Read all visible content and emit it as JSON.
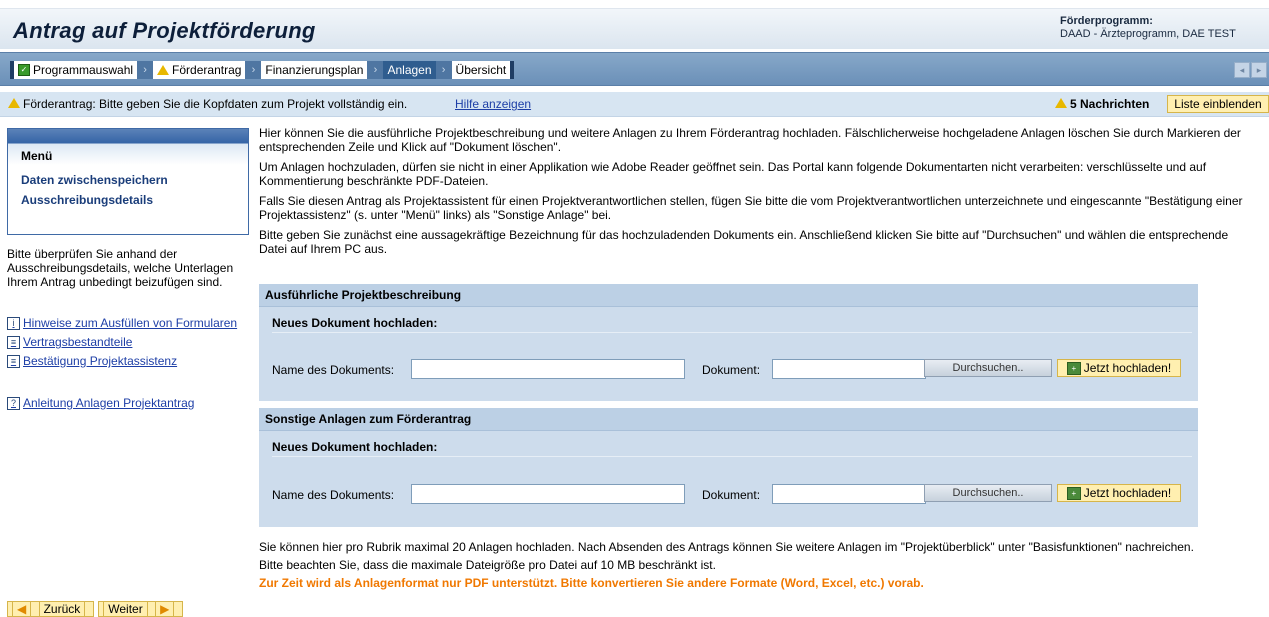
{
  "header": {
    "title": "Antrag auf Projektförderung",
    "program_label": "Förderprogramm:",
    "program_value": "DAAD - Ärzteprogramm, DAE TEST"
  },
  "steps": [
    {
      "label": "Programmauswahl",
      "icon": "check-icon"
    },
    {
      "label": "Förderantrag",
      "icon": "warning-icon"
    },
    {
      "label": "Finanzierungsplan",
      "icon": ""
    },
    {
      "label": "Anlagen",
      "icon": "",
      "active": true
    },
    {
      "label": "Übersicht",
      "icon": ""
    }
  ],
  "messagebar": {
    "message": "Förderantrag: Bitte geben Sie die Kopfdaten zum Projekt vollständig ein.",
    "help": "Hilfe anzeigen",
    "count": "5 Nachrichten",
    "list_button": "Liste einblenden"
  },
  "menu": {
    "title": "Menü",
    "items": [
      "Daten zwischenspeichern",
      "Ausschreibungsdetails"
    ]
  },
  "sidebar": {
    "text": "Bitte überprüfen Sie anhand der Ausschreibungsdetails, welche Unterlagen Ihrem Antrag unbedingt beizufügen sind.",
    "links": [
      "Hinweise zum Ausfüllen von Formularen",
      "Vertragsbestandteile",
      "Bestätigung Projektassistenz",
      "Anleitung Anlagen Projektantrag"
    ]
  },
  "main": {
    "p1": "Hier können Sie die ausführliche Projektbeschreibung und weitere Anlagen zu Ihrem Förderantrag hochladen. Fälschlicherweise hochgeladene Anlagen löschen Sie durch Markieren der entsprechenden Zeile und Klick auf \"Dokument löschen\".",
    "p2": "Um Anlagen hochzuladen, dürfen sie nicht in einer Applikation wie Adobe Reader geöffnet sein. Das Portal kann folgende Dokumentarten nicht verarbeiten: verschlüsselte und auf Kommentierung beschränkte PDF-Dateien.",
    "p3": "Falls Sie diesen Antrag als Projektassistent für einen Projektverantwortlichen stellen, fügen Sie bitte die vom Projektverantwortlichen unterzeichnete und eingescannte \"Bestätigung einer Projektassistenz\" (s. unter \"Menü\" links) als \"Sonstige Anlage\" bei.",
    "p4": "Bitte geben Sie zunächst eine aussagekräftige Bezeichnung für das hochzuladenden Dokuments ein. Anschließend klicken Sie bitte auf \"Durchsuchen\" und wählen die entsprechende Datei auf Ihrem PC aus."
  },
  "sections": [
    {
      "title": "Ausführliche Projektbeschreibung",
      "subtitle": "Neues Dokument hochladen:",
      "name_label": "Name des Dokuments:",
      "name_value": "",
      "doc_label": "Dokument:",
      "doc_value": "",
      "browse": "Durchsuchen..",
      "upload": "Jetzt hochladen!"
    },
    {
      "title": "Sonstige Anlagen zum Förderantrag",
      "subtitle": "Neues Dokument hochladen:",
      "name_label": "Name des Dokuments:",
      "name_value": "",
      "doc_label": "Dokument:",
      "doc_value": "",
      "browse": "Durchsuchen..",
      "upload": "Jetzt hochladen!"
    }
  ],
  "footer": {
    "line1": "Sie können hier pro Rubrik maximal 20 Anlagen hochladen. Nach Absenden des Antrags können Sie weitere Anlagen im \"Projektüberblick\" unter \"Basisfunktionen\" nachreichen.",
    "line2": "Bitte beachten Sie, dass die maximale Dateigröße pro Datei auf 10 MB beschränkt ist.",
    "line3": "Zur Zeit wird als Anlagenformat  nur PDF unterstützt. Bitte konvertieren Sie andere Formate (Word, Excel, etc.) vorab."
  },
  "nav": {
    "back": "Zurück",
    "next": "Weiter"
  },
  "colors": {
    "accent": "#3464a6",
    "highlight": "#ffefb0",
    "warning": "#f07800"
  }
}
